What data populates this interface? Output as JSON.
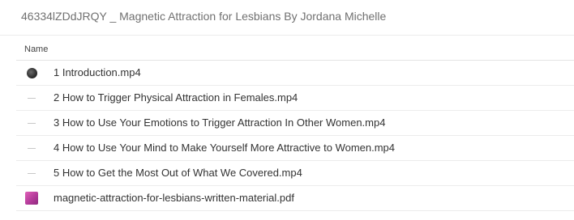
{
  "header": {
    "title": "46334lZDdJRQY _ Magnetic Attraction for Lesbians By Jordana Michelle"
  },
  "columns": {
    "name": "Name"
  },
  "files": [
    {
      "name": "1 Introduction.mp4",
      "icon": "video-thumbnail-icon"
    },
    {
      "name": "2 How to Trigger Physical Attraction in Females.mp4",
      "icon": "blank-thumbnail-icon"
    },
    {
      "name": "3 How to Use Your Emotions to Trigger Attraction In Other Women.mp4",
      "icon": "blank-thumbnail-icon"
    },
    {
      "name": "4 How to Use Your Mind to Make Yourself More Attractive to Women.mp4",
      "icon": "blank-thumbnail-icon"
    },
    {
      "name": "5 How to Get the Most Out of What We Covered.mp4",
      "icon": "blank-thumbnail-icon"
    },
    {
      "name": "magnetic-attraction-for-lesbians-written-material.pdf",
      "icon": "pdf-thumbnail-icon"
    }
  ],
  "colors": {
    "header_text": "#707070",
    "row_text": "#333333",
    "divider": "#ececec",
    "pdf_accent": "#c34aa6"
  }
}
